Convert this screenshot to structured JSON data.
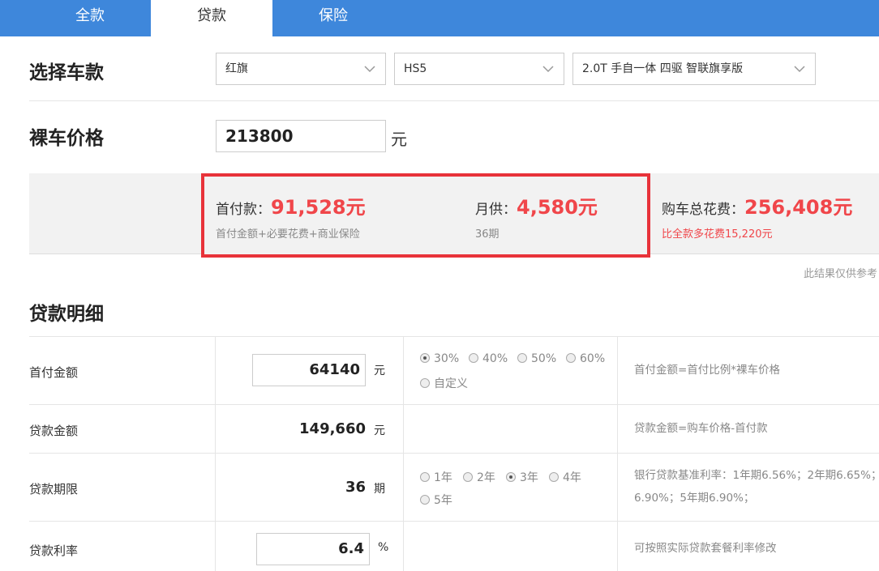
{
  "tabs": [
    {
      "label": "全款",
      "active": false
    },
    {
      "label": "贷款",
      "active": true
    },
    {
      "label": "保险",
      "active": false
    }
  ],
  "select_car": {
    "title": "选择车款",
    "brand": "红旗",
    "model": "HS5",
    "trim": "2.0T 手自一体 四驱 智联旗享版"
  },
  "price": {
    "title": "裸车价格",
    "value": "213800",
    "unit": "元"
  },
  "summary": {
    "down_label": "首付款：",
    "down_value": "91,528元",
    "down_sub": "首付金额+必要花费+商业保险",
    "monthly_label": "月供：",
    "monthly_value": "4,580元",
    "monthly_sub": "36期",
    "total_label": "购车总花费：",
    "total_value": "256,408元",
    "total_sub": "比全款多花费15,220元"
  },
  "disclaimer": "此结果仅供参考",
  "details": {
    "title": "贷款明细",
    "down_payment": {
      "label": "首付金额",
      "value": "64140",
      "unit": "元",
      "options": [
        "30%",
        "40%",
        "50%",
        "60%",
        "自定义"
      ],
      "selected": "30%",
      "hint": "首付金额=首付比例*裸车价格"
    },
    "loan_amount": {
      "label": "贷款金额",
      "value": "149,660",
      "unit": "元",
      "hint": "贷款金额=购车价格-首付款"
    },
    "loan_term": {
      "label": "贷款期限",
      "value": "36",
      "unit": "期",
      "options": [
        "1年",
        "2年",
        "3年",
        "4年",
        "5年"
      ],
      "selected": "3年",
      "hint_line1": "银行贷款基准利率：1年期6.56%；2年期6.65%；",
      "hint_line2": "6.90%；5年期6.90%；"
    },
    "interest_rate": {
      "label": "贷款利率",
      "value": "6.4",
      "unit": "%",
      "hint": "可按照实际贷款套餐利率修改"
    }
  },
  "colors": {
    "tab_bar": "#3e87db",
    "accent_red": "#f0464a",
    "highlight_border": "#e8333a"
  }
}
